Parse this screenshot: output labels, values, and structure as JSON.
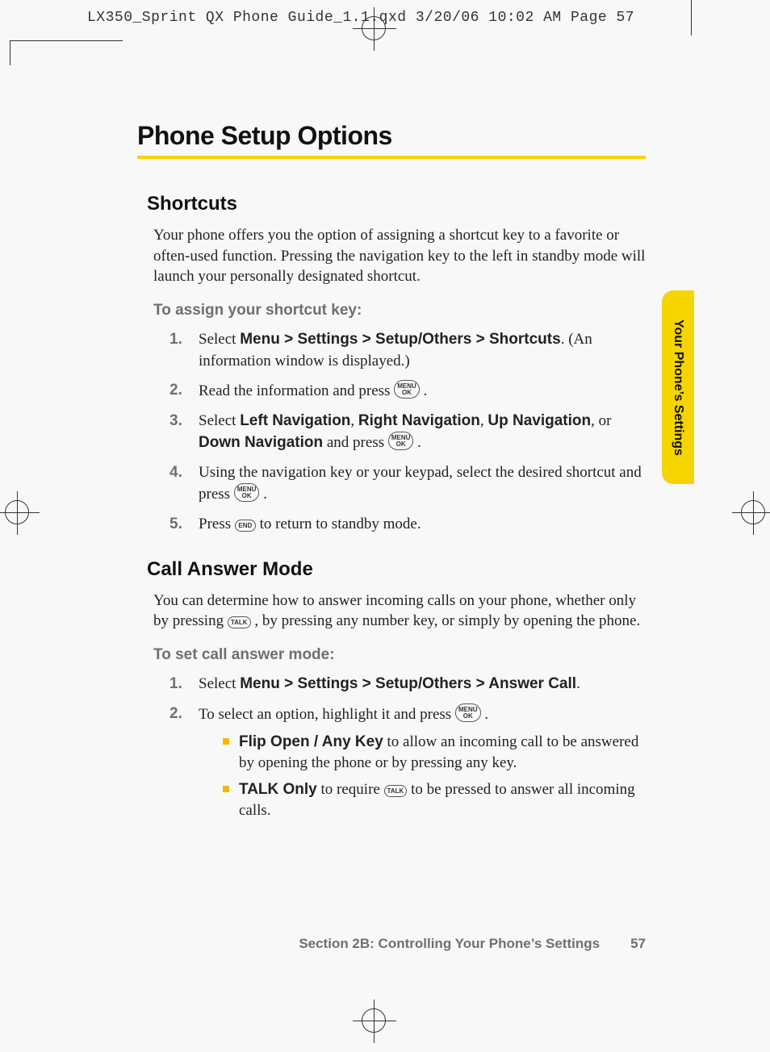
{
  "slug": "LX350_Sprint QX Phone Guide_1.1.qxd  3/20/06  10:02 AM  Page 57",
  "side_tab": "Your Phone’s Settings",
  "title": "Phone Setup Options",
  "shortcuts": {
    "heading": "Shortcuts",
    "intro": "Your phone offers you the option of assigning a shortcut key to a favorite or often-used function. Pressing the navigation key to the left in standby mode will launch your personally designated shortcut.",
    "lead": "To assign your shortcut key:",
    "steps": {
      "n1": "1.",
      "s1_a": "Select ",
      "s1_b": "Menu > Settings > Setup/Others > Shortcuts",
      "s1_c": ". (An information window is displayed.)",
      "n2": "2.",
      "s2_a": "Read the information and press ",
      "s2_key_top": "MENU",
      "s2_key_bot": "OK",
      "s2_c": " .",
      "n3": "3.",
      "s3_a": "Select ",
      "s3_b1": "Left Navigation",
      "s3_m1": ", ",
      "s3_b2": "Right Navigation",
      "s3_m2": ", ",
      "s3_b3": "Up Navigation",
      "s3_m3": ", or ",
      "s3_b4": "Down Navigation",
      "s3_c": " and press ",
      "s3_key_top": "MENU",
      "s3_key_bot": "OK",
      "s3_d": " .",
      "n4": "4.",
      "s4_a": "Using the navigation key or your keypad, select the desired shortcut and press ",
      "s4_key_top": "MENU",
      "s4_key_bot": "OK",
      "s4_c": " .",
      "n5": "5.",
      "s5_a": "Press ",
      "s5_key": "END",
      "s5_c": " to return to standby mode."
    }
  },
  "callanswer": {
    "heading": "Call Answer Mode",
    "intro_a": "You can determine how to answer incoming calls on your phone, whether only by pressing ",
    "intro_key": "TALK",
    "intro_b": " , by pressing any number key, or simply by opening the phone.",
    "lead": "To set call answer mode:",
    "n1": "1.",
    "s1_a": "Select ",
    "s1_b": "Menu > Settings > Setup/Others > Answer Call",
    "s1_c": ".",
    "n2": "2.",
    "s2_a": "To select an option, highlight it and press ",
    "s2_key_top": "MENU",
    "s2_key_bot": "OK",
    "s2_c": " .",
    "b1_b": "Flip Open / Any Key",
    "b1_t": " to allow an incoming call to be answered by opening the phone or by pressing any key.",
    "b2_b": "TALK Only",
    "b2_t1": " to require ",
    "b2_key": "TALK",
    "b2_t2": " to be pressed to answer all incoming calls."
  },
  "footer": {
    "section": "Section 2B: Controlling Your Phone’s Settings",
    "page": "57"
  }
}
